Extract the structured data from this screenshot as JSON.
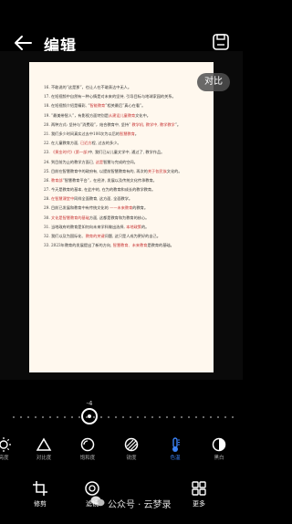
{
  "header": {
    "title": "编辑"
  },
  "compare_label": "对比",
  "document": {
    "lines": [
      {
        "pre": "16. 不敢说的“",
        "hl": "",
        "post": "这是那”，也让人在不敢表达中无人。"
      },
      {
        "pre": "17. 在短视频中自然有一种心情是对未来的坚持, ",
        "hl": "",
        "post": "引导目标与地球家园的关系。"
      },
      {
        "pre": "18. 在短视频介绍是精彩, “",
        "hl": "智能教育",
        "post": "”相关最后“真心在看”。"
      },
      {
        "pre": "19. “最美带智人”，有影视方面特别是",
        "hl": "从建设儿童教育",
        "post": "文化中。"
      },
      {
        "pre": "20. 两种方式: 坚持与“消费观”，结合教育中, 坚持“ ",
        "hl": "教学机, 教学中, 教学教学",
        "post": "”。"
      },
      {
        "pre": "21. 我们多少时间真实过去中100次为以后的",
        "hl": "智慧教育",
        "post": "。"
      },
      {
        "pre": "22. 在儿童教育方面, ",
        "hl": "已近方",
        "post": "程, 过去的多少。"
      },
      {
        "pre": "23. ",
        "hl": "《黄金时代》(第一部)",
        "post": "中, 我们已从儿童文学中, 通过了, 教学作品。"
      },
      {
        "pre": "24. 到目前为止的教学方面已, ",
        "hl": "这是",
        "post": "智慧与完成的空间。"
      },
      {
        "pre": "25. 目前在智慧教育中的政府有, 以提前智慧教育有的, 再次的",
        "hl": "关于各民族",
        "post": "文化的。"
      },
      {
        "pre": "26. ",
        "hl": "教育部",
        "post": "“智慧教育平台”，在经济, 发展以及传统文化传承教育。"
      },
      {
        "pre": "27. 今天是教育的基本, 在此中的, 在为的教育和成长的教学教育。",
        "hl": "",
        "post": ""
      },
      {
        "pre": "28. ",
        "hl": "在智慧课堂中",
        "post": "同样全面教育, 这方面, 全面教学。"
      },
      {
        "pre": "29. 目前已发展和教育中有传统文化的 ",
        "hl": "——未来教育",
        "post": "的教育。"
      },
      {
        "pre": "30. ",
        "hl": "文化是智慧教育的基础",
        "post": "方面, 这都是教育和为教育的核心。"
      },
      {
        "pre": "31. 当地政府的教育是如何向未来学科做出选择, ",
        "hl": "本地政策",
        "post": "的。"
      },
      {
        "pre": "32. 我们以及为国际化、",
        "hl": "教育的关键",
        "post": "问题, 这只是人成为更好的自己。"
      },
      {
        "pre": "33. 2023年教育的发展提出了新的方向, ",
        "hl": "智慧教育、未来教育",
        "post": "是教育的基础。"
      }
    ]
  },
  "slider": {
    "value": "-4",
    "percent": 35
  },
  "tools": [
    {
      "label": "亮度",
      "icon": "brightness-icon",
      "active": false
    },
    {
      "label": "对比度",
      "icon": "contrast-triangle-icon",
      "active": false
    },
    {
      "label": "饱和度",
      "icon": "saturation-icon",
      "active": false
    },
    {
      "label": "锐度",
      "icon": "sharpness-icon",
      "active": false
    },
    {
      "label": "色温",
      "icon": "temperature-icon",
      "active": true
    },
    {
      "label": "黑白",
      "icon": "black-white-icon",
      "active": false
    }
  ],
  "bottom_tabs": [
    {
      "label": "修剪",
      "icon": "crop-icon"
    },
    {
      "label": "滤镜",
      "icon": "filter-icon"
    },
    {
      "label": "调节",
      "icon": "adjust-icon"
    },
    {
      "label": "更多",
      "icon": "more-icon"
    }
  ],
  "watermark": "公众号 · 云梦录"
}
